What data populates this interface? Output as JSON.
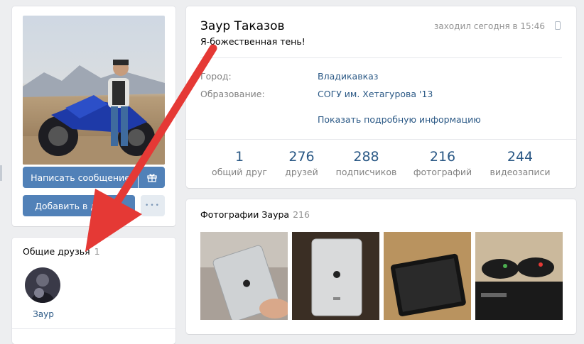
{
  "sidebar": {
    "buttons": {
      "message": "Написать сообщение",
      "add_friend": "Добавить в друзья",
      "more": "•••"
    },
    "mutual_friends": {
      "title": "Общие друзья",
      "count": "1",
      "friends": [
        {
          "name": "Заур"
        }
      ]
    }
  },
  "profile": {
    "name": "Заур Таказов",
    "last_seen": "заходил сегодня в 15:46",
    "status": "Я-божественная тень!",
    "info": [
      {
        "label": "Город:",
        "value": "Владикавказ"
      },
      {
        "label": "Образование:",
        "value": "СОГУ им. Хетагурова '13"
      }
    ],
    "show_more": "Показать подробную информацию",
    "counters": [
      {
        "number": "1",
        "label": "общий друг"
      },
      {
        "number": "276",
        "label": "друзей"
      },
      {
        "number": "288",
        "label": "подписчиков"
      },
      {
        "number": "216",
        "label": "фотографий"
      },
      {
        "number": "244",
        "label": "видеозаписи"
      }
    ]
  },
  "photos": {
    "title": "Фотографии Заура",
    "count": "216"
  },
  "colors": {
    "accent": "#5181b8",
    "link": "#2a5885",
    "annotation_arrow": "#e53935"
  },
  "icons": [
    "gift-icon",
    "phone-icon",
    "more-icon"
  ]
}
